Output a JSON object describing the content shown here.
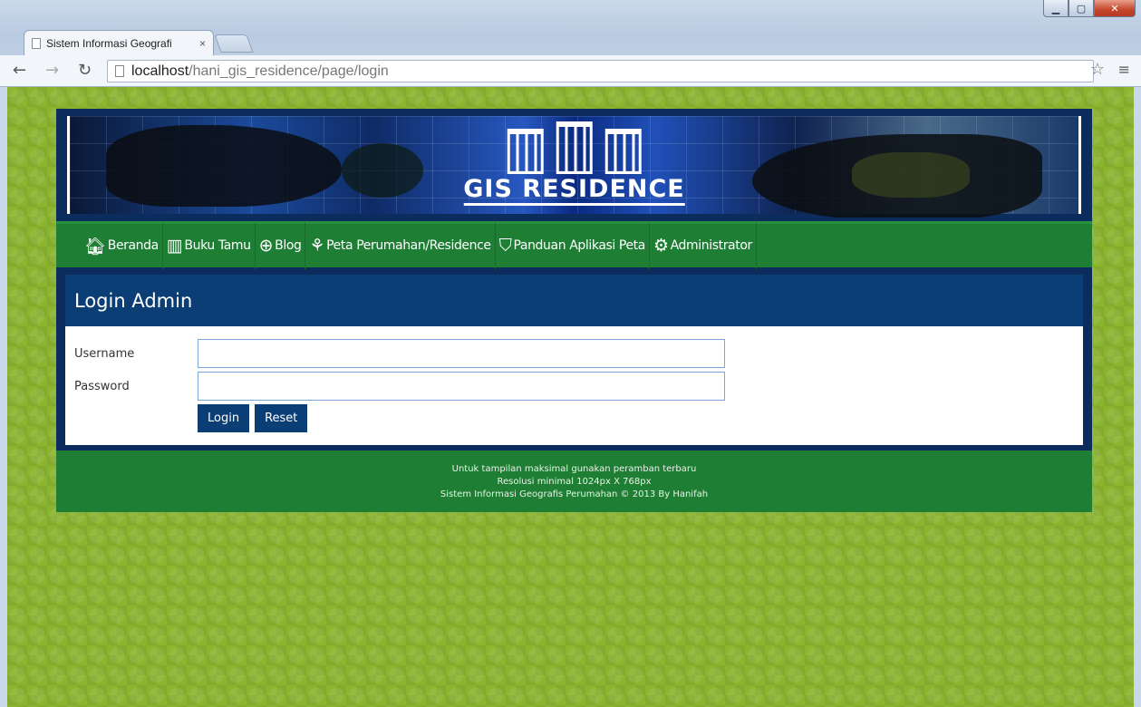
{
  "browser": {
    "tab_title": "Sistem Informasi Geografi",
    "tab_close": "×",
    "url_host": "localhost",
    "url_path": "/hani_gis_residence/page/login"
  },
  "banner": {
    "title": "GIS RESIDENCE"
  },
  "nav": {
    "items": [
      {
        "label": "Beranda",
        "icon": "home-icon"
      },
      {
        "label": "Buku Tamu",
        "icon": "books-icon"
      },
      {
        "label": "Blog",
        "icon": "globe-icon"
      },
      {
        "label": "Peta Perumahan/Residence",
        "icon": "map-icon"
      },
      {
        "label": "Panduan Aplikasi Peta",
        "icon": "help-shield-icon"
      },
      {
        "label": "Administrator",
        "icon": "admin-icon"
      }
    ]
  },
  "login": {
    "heading": "Login Admin",
    "username_label": "Username",
    "password_label": "Password",
    "username_value": "",
    "password_value": "",
    "login_button": "Login",
    "reset_button": "Reset"
  },
  "footer": {
    "line1": "Untuk tampilan maksimal gunakan peramban terbaru",
    "line2": "Resolusi minimal 1024px X 768px",
    "line3": "Sistem Informasi Geografis Perumahan © 2013 By Hanifah"
  },
  "colors": {
    "page_bg": "#8bb42f",
    "nav_green": "#1e7e34",
    "navy": "#0b3e74"
  }
}
